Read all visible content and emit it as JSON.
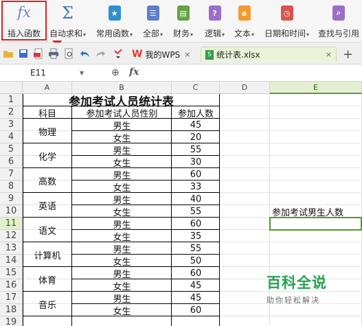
{
  "ribbon": {
    "buttons": [
      {
        "label": "插入函数",
        "icon": "fx-icon",
        "dropdown": false
      },
      {
        "label": "自动求和",
        "icon": "sigma-icon",
        "dropdown": true
      },
      {
        "label": "常用函数",
        "icon": "star-book-icon",
        "dropdown": true
      },
      {
        "label": "全部",
        "icon": "book-icon",
        "dropdown": true
      },
      {
        "label": "财务",
        "icon": "finance-icon",
        "dropdown": true
      },
      {
        "label": "逻辑",
        "icon": "question-book-icon",
        "dropdown": true
      },
      {
        "label": "文本",
        "icon": "text-a-icon",
        "dropdown": true
      },
      {
        "label": "日期和时间",
        "icon": "clock-book-icon",
        "dropdown": true
      },
      {
        "label": "查找与引用",
        "icon": "search-book-icon",
        "dropdown": false
      }
    ],
    "dropdown_arrow": "▾",
    "icon_glyphs": {
      "fx": "fx",
      "sigma": "Σ",
      "question": "?",
      "text": "a"
    },
    "colors": {
      "highlight": "#e02020",
      "fx": "#6a86c7",
      "sigma": "#4a76c2",
      "star": "#2f8fd0",
      "book": "#5b7fcb",
      "finance": "#62a244",
      "question": "#9b6fc9",
      "text": "#f39a2e",
      "clock": "#d9534f",
      "search": "#9b6fc9"
    }
  },
  "tabs": [
    {
      "label": "我的WPS",
      "close": "×"
    },
    {
      "label": "统计表.xlsx",
      "close": "×"
    }
  ],
  "new_tab": "+",
  "formula_bar": {
    "cell_ref": "E11",
    "fx": "fx",
    "zoom_glyph": "⊕"
  },
  "columns": [
    "A",
    "B",
    "C",
    "D",
    "E"
  ],
  "selected_column": "E",
  "rows": [
    "1",
    "2",
    "3",
    "4",
    "5",
    "6",
    "7",
    "8",
    "9",
    "10",
    "11",
    "12",
    "13",
    "14",
    "15",
    "16",
    "17",
    "18",
    "19"
  ],
  "selected_row": "11",
  "table": {
    "title": "参加考试人员统计表",
    "headers": [
      "科目",
      "参加考试人员性别",
      "参加人数"
    ],
    "subjects": [
      "物理",
      "化学",
      "高数",
      "英语",
      "语文",
      "计算机",
      "体育",
      "音乐"
    ],
    "data": [
      [
        "男生",
        "45"
      ],
      [
        "女生",
        "20"
      ],
      [
        "男生",
        "55"
      ],
      [
        "女生",
        "30"
      ],
      [
        "男生",
        "60"
      ],
      [
        "女生",
        "33"
      ],
      [
        "男生",
        "40"
      ],
      [
        "女生",
        "55"
      ],
      [
        "男生",
        "60"
      ],
      [
        "女生",
        "35"
      ],
      [
        "男生",
        "55"
      ],
      [
        "女生",
        "50"
      ],
      [
        "男生",
        "60"
      ],
      [
        "女生",
        "45"
      ],
      [
        "男生",
        "45"
      ],
      [
        "女生",
        "60"
      ]
    ]
  },
  "e10_label": "参加考试男生人数",
  "watermark": {
    "main": "百科全说",
    "sub": "助你轻松解决"
  }
}
